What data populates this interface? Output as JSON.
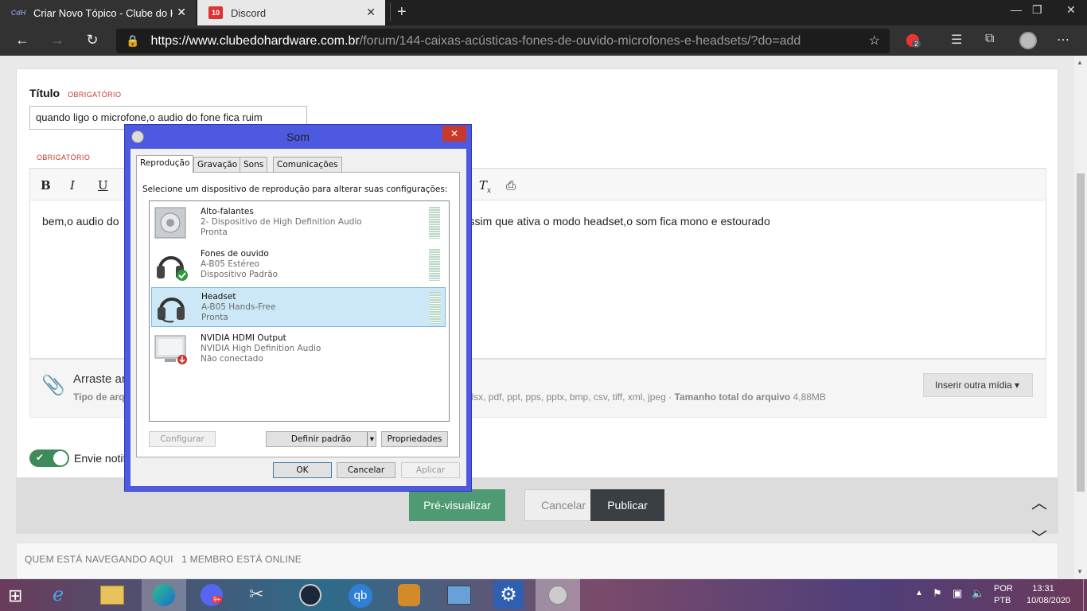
{
  "browser": {
    "tabs": [
      {
        "title": "Criar Novo Tópico - Clube do Ha",
        "favicon": "CdH"
      },
      {
        "title": "Discord",
        "favicon": "10"
      }
    ],
    "url_host": "https://www.clubedohardware.com.br",
    "url_path": "/forum/144-caixas-acústicas-fones-de-ouvido-microfones-e-headsets/?do=add",
    "extension_badge": "2"
  },
  "form": {
    "title_label": "Título",
    "required": "OBRIGATÓRIO",
    "title_value": "quando ligo o microfone,o audio do fone fica ruim",
    "editor_text_start": "bem,o audio do",
    "editor_text_end": "ssim que ativa o modo headset,o som fica mono e estourado",
    "drag_text": "Arraste ar",
    "types_start": "Tipo de arq",
    "types_end": "xlsx, pdf, ppt, pps, pptx, bmp, csv, tiff, xml, jpeg ·",
    "total_size_label": "Tamanho total do arquivo",
    "total_size_value": "4,88MB",
    "insert_media": "Inserir outra mídia ▾",
    "notify_label": "Envie notif",
    "buttons": {
      "preview": "Pré-visualizar",
      "cancel": "Cancelar",
      "publish": "Publicar"
    }
  },
  "online": {
    "heading": "QUEM ESTÁ NAVEGANDO AQUI",
    "count": "1 MEMBRO ESTÁ ONLINE"
  },
  "dialog": {
    "title": "Som",
    "tabs": [
      "Reprodução",
      "Gravação",
      "Sons",
      "Comunicações"
    ],
    "instruction": "Selecione um dispositivo de reprodução para alterar suas configurações:",
    "devices": [
      {
        "name": "Alto-falantes",
        "line2": "2- Dispositivo de High Definition Audio",
        "line3": "Pronta"
      },
      {
        "name": "Fones de ouvido",
        "line2": "A-B05 Estéreo",
        "line3": "Dispositivo Padrão"
      },
      {
        "name": "Headset",
        "line2": "A-B05 Hands-Free",
        "line3": "Pronta"
      },
      {
        "name": "NVIDIA HDMI Output",
        "line2": "NVIDIA High Definition Audio",
        "line3": "Não conectado"
      }
    ],
    "buttons": {
      "configure": "Configurar",
      "set_default": "Definir padrão",
      "properties": "Propriedades",
      "ok": "OK",
      "cancel": "Cancelar",
      "apply": "Aplicar"
    }
  },
  "taskbar": {
    "discord_badge": "9+",
    "lang1": "POR",
    "lang2": "PTB",
    "time": "13:31",
    "date": "10/08/2020"
  }
}
